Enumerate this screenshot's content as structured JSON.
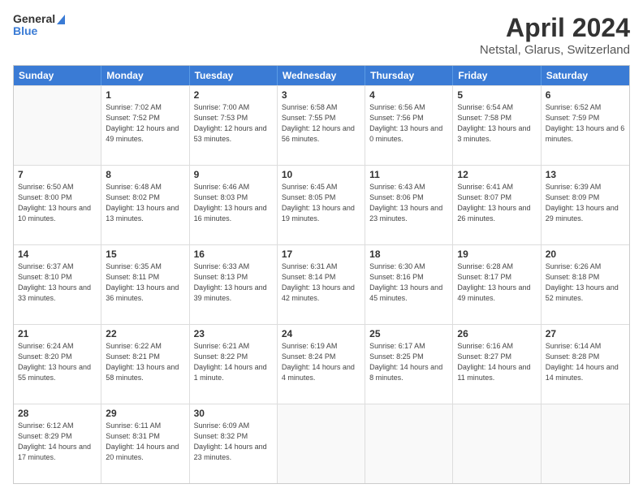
{
  "header": {
    "logo_line1": "General",
    "logo_line2": "Blue",
    "title": "April 2024",
    "subtitle": "Netstal, Glarus, Switzerland"
  },
  "weekdays": [
    "Sunday",
    "Monday",
    "Tuesday",
    "Wednesday",
    "Thursday",
    "Friday",
    "Saturday"
  ],
  "weeks": [
    [
      {
        "day": "",
        "sunrise": "",
        "sunset": "",
        "daylight": ""
      },
      {
        "day": "1",
        "sunrise": "Sunrise: 7:02 AM",
        "sunset": "Sunset: 7:52 PM",
        "daylight": "Daylight: 12 hours and 49 minutes."
      },
      {
        "day": "2",
        "sunrise": "Sunrise: 7:00 AM",
        "sunset": "Sunset: 7:53 PM",
        "daylight": "Daylight: 12 hours and 53 minutes."
      },
      {
        "day": "3",
        "sunrise": "Sunrise: 6:58 AM",
        "sunset": "Sunset: 7:55 PM",
        "daylight": "Daylight: 12 hours and 56 minutes."
      },
      {
        "day": "4",
        "sunrise": "Sunrise: 6:56 AM",
        "sunset": "Sunset: 7:56 PM",
        "daylight": "Daylight: 13 hours and 0 minutes."
      },
      {
        "day": "5",
        "sunrise": "Sunrise: 6:54 AM",
        "sunset": "Sunset: 7:58 PM",
        "daylight": "Daylight: 13 hours and 3 minutes."
      },
      {
        "day": "6",
        "sunrise": "Sunrise: 6:52 AM",
        "sunset": "Sunset: 7:59 PM",
        "daylight": "Daylight: 13 hours and 6 minutes."
      }
    ],
    [
      {
        "day": "7",
        "sunrise": "Sunrise: 6:50 AM",
        "sunset": "Sunset: 8:00 PM",
        "daylight": "Daylight: 13 hours and 10 minutes."
      },
      {
        "day": "8",
        "sunrise": "Sunrise: 6:48 AM",
        "sunset": "Sunset: 8:02 PM",
        "daylight": "Daylight: 13 hours and 13 minutes."
      },
      {
        "day": "9",
        "sunrise": "Sunrise: 6:46 AM",
        "sunset": "Sunset: 8:03 PM",
        "daylight": "Daylight: 13 hours and 16 minutes."
      },
      {
        "day": "10",
        "sunrise": "Sunrise: 6:45 AM",
        "sunset": "Sunset: 8:05 PM",
        "daylight": "Daylight: 13 hours and 19 minutes."
      },
      {
        "day": "11",
        "sunrise": "Sunrise: 6:43 AM",
        "sunset": "Sunset: 8:06 PM",
        "daylight": "Daylight: 13 hours and 23 minutes."
      },
      {
        "day": "12",
        "sunrise": "Sunrise: 6:41 AM",
        "sunset": "Sunset: 8:07 PM",
        "daylight": "Daylight: 13 hours and 26 minutes."
      },
      {
        "day": "13",
        "sunrise": "Sunrise: 6:39 AM",
        "sunset": "Sunset: 8:09 PM",
        "daylight": "Daylight: 13 hours and 29 minutes."
      }
    ],
    [
      {
        "day": "14",
        "sunrise": "Sunrise: 6:37 AM",
        "sunset": "Sunset: 8:10 PM",
        "daylight": "Daylight: 13 hours and 33 minutes."
      },
      {
        "day": "15",
        "sunrise": "Sunrise: 6:35 AM",
        "sunset": "Sunset: 8:11 PM",
        "daylight": "Daylight: 13 hours and 36 minutes."
      },
      {
        "day": "16",
        "sunrise": "Sunrise: 6:33 AM",
        "sunset": "Sunset: 8:13 PM",
        "daylight": "Daylight: 13 hours and 39 minutes."
      },
      {
        "day": "17",
        "sunrise": "Sunrise: 6:31 AM",
        "sunset": "Sunset: 8:14 PM",
        "daylight": "Daylight: 13 hours and 42 minutes."
      },
      {
        "day": "18",
        "sunrise": "Sunrise: 6:30 AM",
        "sunset": "Sunset: 8:16 PM",
        "daylight": "Daylight: 13 hours and 45 minutes."
      },
      {
        "day": "19",
        "sunrise": "Sunrise: 6:28 AM",
        "sunset": "Sunset: 8:17 PM",
        "daylight": "Daylight: 13 hours and 49 minutes."
      },
      {
        "day": "20",
        "sunrise": "Sunrise: 6:26 AM",
        "sunset": "Sunset: 8:18 PM",
        "daylight": "Daylight: 13 hours and 52 minutes."
      }
    ],
    [
      {
        "day": "21",
        "sunrise": "Sunrise: 6:24 AM",
        "sunset": "Sunset: 8:20 PM",
        "daylight": "Daylight: 13 hours and 55 minutes."
      },
      {
        "day": "22",
        "sunrise": "Sunrise: 6:22 AM",
        "sunset": "Sunset: 8:21 PM",
        "daylight": "Daylight: 13 hours and 58 minutes."
      },
      {
        "day": "23",
        "sunrise": "Sunrise: 6:21 AM",
        "sunset": "Sunset: 8:22 PM",
        "daylight": "Daylight: 14 hours and 1 minute."
      },
      {
        "day": "24",
        "sunrise": "Sunrise: 6:19 AM",
        "sunset": "Sunset: 8:24 PM",
        "daylight": "Daylight: 14 hours and 4 minutes."
      },
      {
        "day": "25",
        "sunrise": "Sunrise: 6:17 AM",
        "sunset": "Sunset: 8:25 PM",
        "daylight": "Daylight: 14 hours and 8 minutes."
      },
      {
        "day": "26",
        "sunrise": "Sunrise: 6:16 AM",
        "sunset": "Sunset: 8:27 PM",
        "daylight": "Daylight: 14 hours and 11 minutes."
      },
      {
        "day": "27",
        "sunrise": "Sunrise: 6:14 AM",
        "sunset": "Sunset: 8:28 PM",
        "daylight": "Daylight: 14 hours and 14 minutes."
      }
    ],
    [
      {
        "day": "28",
        "sunrise": "Sunrise: 6:12 AM",
        "sunset": "Sunset: 8:29 PM",
        "daylight": "Daylight: 14 hours and 17 minutes."
      },
      {
        "day": "29",
        "sunrise": "Sunrise: 6:11 AM",
        "sunset": "Sunset: 8:31 PM",
        "daylight": "Daylight: 14 hours and 20 minutes."
      },
      {
        "day": "30",
        "sunrise": "Sunrise: 6:09 AM",
        "sunset": "Sunset: 8:32 PM",
        "daylight": "Daylight: 14 hours and 23 minutes."
      },
      {
        "day": "",
        "sunrise": "",
        "sunset": "",
        "daylight": ""
      },
      {
        "day": "",
        "sunrise": "",
        "sunset": "",
        "daylight": ""
      },
      {
        "day": "",
        "sunrise": "",
        "sunset": "",
        "daylight": ""
      },
      {
        "day": "",
        "sunrise": "",
        "sunset": "",
        "daylight": ""
      }
    ]
  ]
}
